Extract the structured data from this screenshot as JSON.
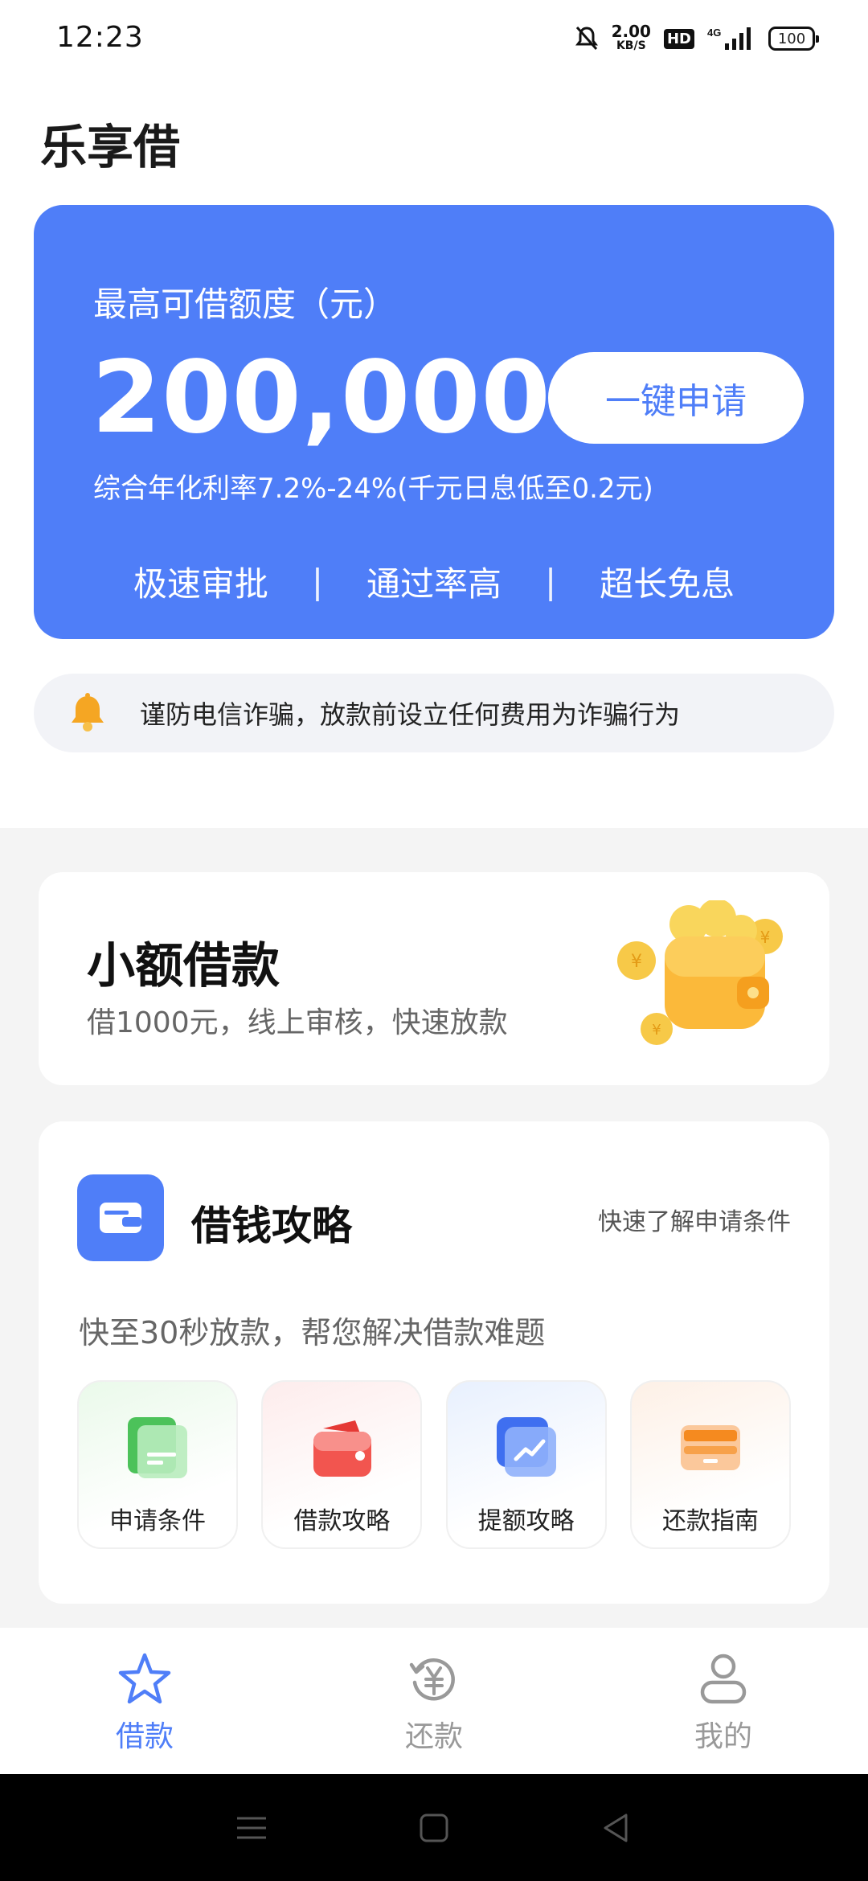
{
  "status_bar": {
    "time": "12:23",
    "net_speed": "2.00",
    "net_unit": "KB/S",
    "hd": "HD",
    "network": "4G",
    "battery": "100"
  },
  "app": {
    "title": "乐享借"
  },
  "hero": {
    "label": "最高可借额度（元）",
    "amount": "200,000",
    "apply_button": "一键申请",
    "rate_text": "综合年化利率7.2%-24%(千元日息低至0.2元)",
    "features": [
      "极速审批",
      "通过率高",
      "超长免息"
    ],
    "separator": "|",
    "bg_color": "#4f7ef8"
  },
  "notice": {
    "icon": "bell-icon",
    "text": "谨防电信诈骗，放款前设立任何费用为诈骗行为"
  },
  "small_loan": {
    "title": "小额借款",
    "subtitle": "借1000元，线上审核，快速放款",
    "icon": "wallet-coins-icon"
  },
  "guide": {
    "title": "借钱攻略",
    "link": "快速了解申请条件",
    "description": "快至30秒放款，帮您解决借款难题",
    "tiles": [
      {
        "label": "申请条件",
        "icon": "green-card-icon"
      },
      {
        "label": "借款攻略",
        "icon": "red-wallet-icon"
      },
      {
        "label": "提额攻略",
        "icon": "blue-chart-icon"
      },
      {
        "label": "还款指南",
        "icon": "orange-card-icon"
      }
    ]
  },
  "tabbar": {
    "items": [
      {
        "label": "借款",
        "icon": "star-icon",
        "active": true
      },
      {
        "label": "还款",
        "icon": "yen-cycle-icon",
        "active": false
      },
      {
        "label": "我的",
        "icon": "person-icon",
        "active": false
      }
    ]
  }
}
